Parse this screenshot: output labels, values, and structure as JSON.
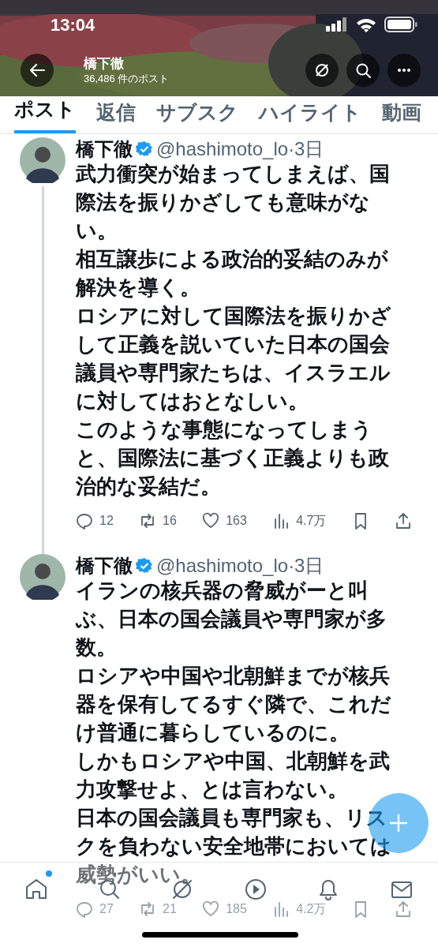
{
  "status_bar": {
    "time": "13:04"
  },
  "header": {
    "title": "橋下徹",
    "subtitle": "36,486 件のポスト"
  },
  "tabs": [
    {
      "label": "ポスト",
      "selected": true
    },
    {
      "label": "返信",
      "selected": false
    },
    {
      "label": "サブスク",
      "selected": false
    },
    {
      "label": "ハイライト",
      "selected": false
    },
    {
      "label": "動画",
      "selected": false
    }
  ],
  "posts": [
    {
      "name": "橋下徹",
      "verified": true,
      "handle": "@hashimoto_lo",
      "time": "·3日",
      "thread": true,
      "paragraphs": [
        "武力衝突が始まってしまえば、国際法を振りかざしても意味がない。",
        "相互譲歩による政治的妥結のみが解決を導く。",
        "ロシアに対して国際法を振りかざして正義を説いていた日本の国会議員や専門家たちは、イスラエルに対してはおとなしい。",
        "このような事態になってしまうと、国際法に基づく正義よりも政治的な妥結だ。"
      ],
      "replies": "12",
      "reposts": "16",
      "likes": "163",
      "views": "4.7万"
    },
    {
      "name": "橋下徹",
      "verified": true,
      "handle": "@hashimoto_lo",
      "time": "·3日",
      "thread": false,
      "paragraphs": [
        "イランの核兵器の脅威がーと叫ぶ、日本の国会議員や専門家が多数。",
        "ロシアや中国や北朝鮮までが核兵器を保有してるすぐ隣で、これだけ普通に暮らしているのに。",
        "しかもロシアや中国、北朝鮮を武力攻撃せよ、とは言わない。",
        "日本の国会議員も専門家も、リスクを負わない安全地帯においては威勢がいい。"
      ],
      "replies": "27",
      "reposts": "21",
      "likes": "185",
      "views": "4.2万"
    }
  ]
}
